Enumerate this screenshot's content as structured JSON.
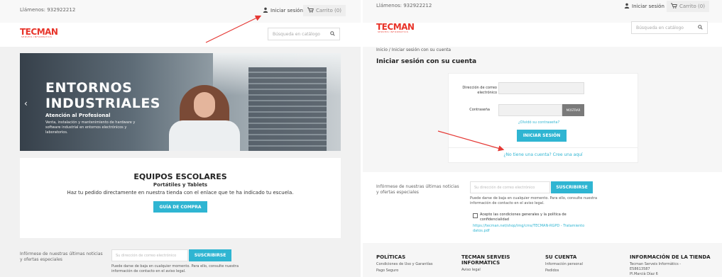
{
  "left": {
    "header": {
      "phone": "Llámenos: 932922212",
      "login_label": "Iniciar sesión",
      "cart_label": "Carrito (0)",
      "logo": "TECMAN",
      "logo_sub": "SERVEIS INFORMÀTICS",
      "search_placeholder": "Búsqueda en catálogo"
    },
    "hero": {
      "title_line1": "ENTORNOS",
      "title_line2": "INDUSTRIALES",
      "subtitle": "Atención al Profesional",
      "description": "Venta, instalación y mantenimiento de hardware y software industrial en entornos electrónicos y laboratorios."
    },
    "escolar": {
      "title": "EQUIPOS ESCOLARES",
      "subtitle": "Portátiles y Tablets",
      "description": "Haz tu pedido directamente en nuestra tienda con el enlace que te ha indicado tu escuela.",
      "button": "GUÍA DE COMPRA"
    },
    "newsletter": {
      "label": "Infórmese de nuestras últimas noticias y ofertas especiales",
      "placeholder": "Su dirección de correo electrónico",
      "button": "SUSCRIBIRSE",
      "note": "Puede darse de baja en cualquier momento. Para ello, consulte nuestra información de contacto en el aviso legal."
    }
  },
  "right": {
    "header": {
      "phone": "Llámenos: 932922212",
      "login_label": "Iniciar sesión",
      "cart_label": "Carrito (0)",
      "logo": "TECMAN",
      "logo_sub": "SERVEIS INFORMÀTICS",
      "search_placeholder": "Búsqueda en catálogo"
    },
    "breadcrumb": "Inicio  /  Iniciar sesión con su cuenta",
    "page_title": "Iniciar sesión con su cuenta",
    "form": {
      "email_label": "Dirección de correo electrónico",
      "password_label": "Contraseña",
      "show_button": "MOSTRAR",
      "forgot_link": "¿Olvidó su contraseña?",
      "login_button": "INICIAR SESIÓN",
      "create_link": "¿No tiene una cuenta? Cree una aquí"
    },
    "newsletter": {
      "label": "Infórmese de nuestras últimas noticias y ofertas especiales",
      "placeholder": "Su dirección de correo electrónico",
      "button": "SUSCRIBIRSE",
      "note": "Puede darse de baja en cualquier momento. Para ello, consulte nuestra información de contacto en el aviso legal.",
      "consent": "Acepto las condiciones generales y la política de confidencialidad",
      "consent_link": "https://tecman.net/shop/img/cms/TECMAN-RGPD - Tratamiento datos.pdf"
    },
    "footer": {
      "col1_title": "POLÍTICAS",
      "col1_items": [
        "Condiciones de Uso y Garantías",
        "Pago Seguro"
      ],
      "col2_title": "TECMAN SERVEIS INFORMÀTICS",
      "col2_items": [
        "Aviso legal"
      ],
      "col3_title": "SU CUENTA",
      "col3_items": [
        "Información personal",
        "Pedidos"
      ],
      "col4_title": "INFORMACIÓN DE LA TIENDA",
      "col4_items": [
        "Tecman Serveis Informàtics -",
        "E58613587",
        "Pl.Marcià Díaz 6"
      ]
    }
  },
  "colors": {
    "accent": "#2fb5d2",
    "brand": "#e8342a",
    "annotation": "#e53935"
  }
}
